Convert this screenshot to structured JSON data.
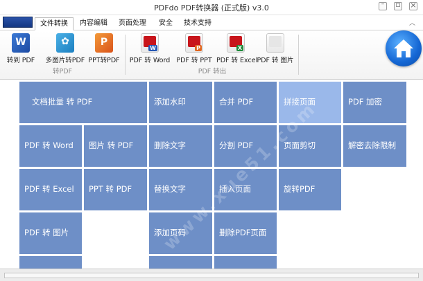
{
  "window": {
    "title": "PDFdo  PDF转换器 (正式版) v3.0"
  },
  "tabs": [
    {
      "label": "文件转换",
      "active": true
    },
    {
      "label": "内容编辑",
      "active": false
    },
    {
      "label": "页面处理",
      "active": false
    },
    {
      "label": "安全",
      "active": false
    },
    {
      "label": "技术支持",
      "active": false
    }
  ],
  "ribbon": {
    "group1": {
      "label": "转PDF",
      "buttons": [
        {
          "label": "转到 PDF",
          "icon": "word-doc-icon"
        },
        {
          "label": "多图片转PDF",
          "icon": "image-icon"
        },
        {
          "label": "PPT转PDF",
          "icon": "ppt-icon"
        }
      ]
    },
    "group2": {
      "label": "PDF 转出",
      "buttons": [
        {
          "label": "PDF 转 Word",
          "icon": "pdf-to-word-icon"
        },
        {
          "label": "PDF 转 PPT",
          "icon": "pdf-to-ppt-icon"
        },
        {
          "label": "PDF 转 Excel",
          "icon": "pdf-to-excel-icon"
        },
        {
          "label": "PDF 转 图片",
          "icon": "pdf-to-image-icon"
        }
      ]
    }
  },
  "home_icon": "home-icon",
  "tiles": {
    "batch": "文档批量 转 PDF",
    "pdf_word": "PDF 转 Word",
    "img_pdf": "图片 转 PDF",
    "pdf_excel": "PDF 转 Excel",
    "ppt_pdf": "PPT 转 PDF",
    "pdf_image": "PDF 转 图片",
    "add_watermark": "添加水印",
    "delete_text": "删除文字",
    "replace_text": "替换文字",
    "add_page_number": "添加页码",
    "merge_pdf": "合并 PDF",
    "split_pdf": "分割 PDF",
    "insert_page": "插入页面",
    "delete_pdf_page": "删除PDF页面",
    "join_pages": "拼接页面",
    "crop_page": "页面剪切",
    "rotate_pdf": "旋转PDF",
    "encrypt_pdf": "PDF 加密",
    "decrypt": "解密去除限制"
  },
  "colors": {
    "tile": "#6e8fc7",
    "tile_highlight": "#9ab8ea",
    "accent": "#1567d4"
  }
}
